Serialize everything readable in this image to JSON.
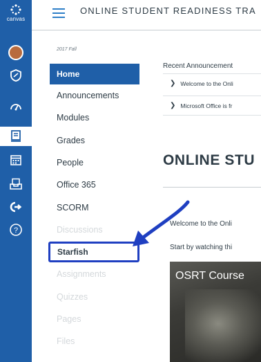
{
  "global_nav": {
    "logo_label": "canvas",
    "items": [
      {
        "icon": "account-avatar-icon"
      },
      {
        "icon": "admin-shield-icon"
      },
      {
        "icon": "dashboard-icon"
      },
      {
        "icon": "courses-icon",
        "active": true
      },
      {
        "icon": "calendar-icon"
      },
      {
        "icon": "inbox-icon"
      },
      {
        "icon": "commons-icon"
      },
      {
        "icon": "help-icon"
      }
    ]
  },
  "header": {
    "course_title": "ONLINE STUDENT READINESS TRA"
  },
  "course_nav": {
    "term": "2017 Fall",
    "items": [
      {
        "label": "Home",
        "active": true
      },
      {
        "label": "Announcements"
      },
      {
        "label": "Modules"
      },
      {
        "label": "Grades"
      },
      {
        "label": "People"
      },
      {
        "label": "Office 365"
      },
      {
        "label": "SCORM"
      },
      {
        "label": "Discussions",
        "disabled": true
      },
      {
        "label": "Starfish",
        "highlighted": true
      },
      {
        "label": "Assignments",
        "disabled": true
      },
      {
        "label": "Quizzes",
        "disabled": true
      },
      {
        "label": "Pages",
        "disabled": true
      },
      {
        "label": "Files",
        "disabled": true
      }
    ]
  },
  "main": {
    "recent_announcements_label": "Recent Announcement",
    "announcements": [
      "Welcome to the Onli",
      "Microsoft Office is fr"
    ],
    "page_heading": "ONLINE STU",
    "welcome_text": "Welcome to the Onli",
    "start_text": "Start by watching thi",
    "video_title": "OSRT Course"
  },
  "colors": {
    "nav_blue": "#1f5fa8",
    "highlight_border": "#1f3fc1",
    "annotation_arrow": "#1f3fc1"
  }
}
